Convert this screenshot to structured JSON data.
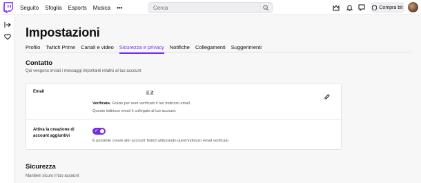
{
  "topbar": {
    "logo_icon": "twitch-glitch-icon",
    "nav": [
      "Seguito",
      "Sfoglia",
      "Esports",
      "Musica"
    ],
    "more_label": "•••",
    "search_placeholder": "Cerca",
    "buy_label": "Compra bit",
    "accent_color": "#772ce8"
  },
  "page": {
    "title": "Impostazioni",
    "tabs": [
      {
        "label": "Profilo",
        "active": false
      },
      {
        "label": "Twitch Prime",
        "active": false
      },
      {
        "label": "Canali e video",
        "active": false
      },
      {
        "label": "Sicurezza e privacy",
        "active": true
      },
      {
        "label": "Notifiche",
        "active": false
      },
      {
        "label": "Collegamenti",
        "active": false
      },
      {
        "label": "Suggerimenti",
        "active": false
      }
    ]
  },
  "contact": {
    "title": "Contatto",
    "subtitle": "Qui vengono inviati i messaggi importanti relativi al tuo account",
    "email_label": "Email",
    "email_value": "il.it",
    "verified_bold": "Verificata.",
    "verified_text": " Grazie per aver verificato il tuo indirizzo email.",
    "linked_text": "Questo indirizzo email è collegato al tuo account.",
    "toggle_label": "Attiva la creazione di account aggiuntivi",
    "toggle_on": true,
    "toggle_help": "È possibile creare altri account Twitch utilizzando quest'indirizzo email verificato"
  },
  "security": {
    "title": "Sicurezza",
    "subtitle": "Mantieni sicuro il tuo account"
  }
}
